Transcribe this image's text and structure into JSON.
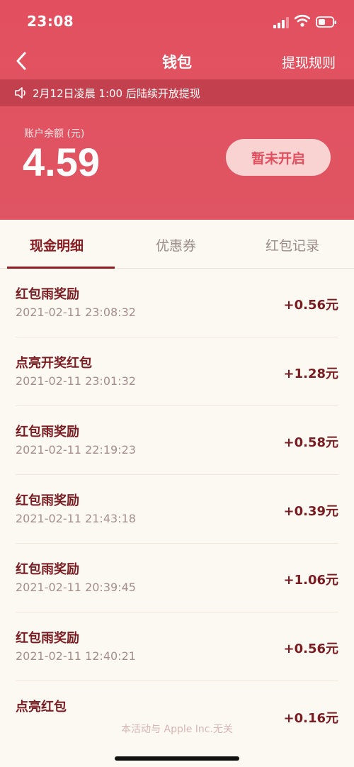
{
  "status": {
    "time": "23:08"
  },
  "nav": {
    "title": "钱包",
    "right_label": "提现规则"
  },
  "notice": {
    "text": "2月12日凌晨 1:00 后陆续开放提现"
  },
  "balance": {
    "label": "账户余额 (元)",
    "value": "4.59",
    "button_label": "暂未开启"
  },
  "tabs": [
    {
      "label": "现金明细",
      "active": true
    },
    {
      "label": "优惠券",
      "active": false
    },
    {
      "label": "红包记录",
      "active": false
    }
  ],
  "records": [
    {
      "title": "红包雨奖励",
      "date": "2021-02-11 23:08:32",
      "amount": "+0.56元"
    },
    {
      "title": "点亮开奖红包",
      "date": "2021-02-11 23:01:32",
      "amount": "+1.28元"
    },
    {
      "title": "红包雨奖励",
      "date": "2021-02-11 22:19:23",
      "amount": "+0.58元"
    },
    {
      "title": "红包雨奖励",
      "date": "2021-02-11 21:43:18",
      "amount": "+0.39元"
    },
    {
      "title": "红包雨奖励",
      "date": "2021-02-11 20:39:45",
      "amount": "+1.06元"
    },
    {
      "title": "红包雨奖励",
      "date": "2021-02-11 12:40:21",
      "amount": "+0.56元"
    },
    {
      "title": "点亮红包",
      "date": "",
      "amount": "+0.16元"
    }
  ],
  "footer": {
    "note": "本活动与 Apple Inc.无关"
  },
  "colors": {
    "header": "#e2505f",
    "accent": "#8a1c22",
    "background": "#fcf8f2"
  },
  "icons": [
    "signal-icon",
    "wifi-icon",
    "battery-icon",
    "back-arrow-icon",
    "speaker-icon"
  ]
}
